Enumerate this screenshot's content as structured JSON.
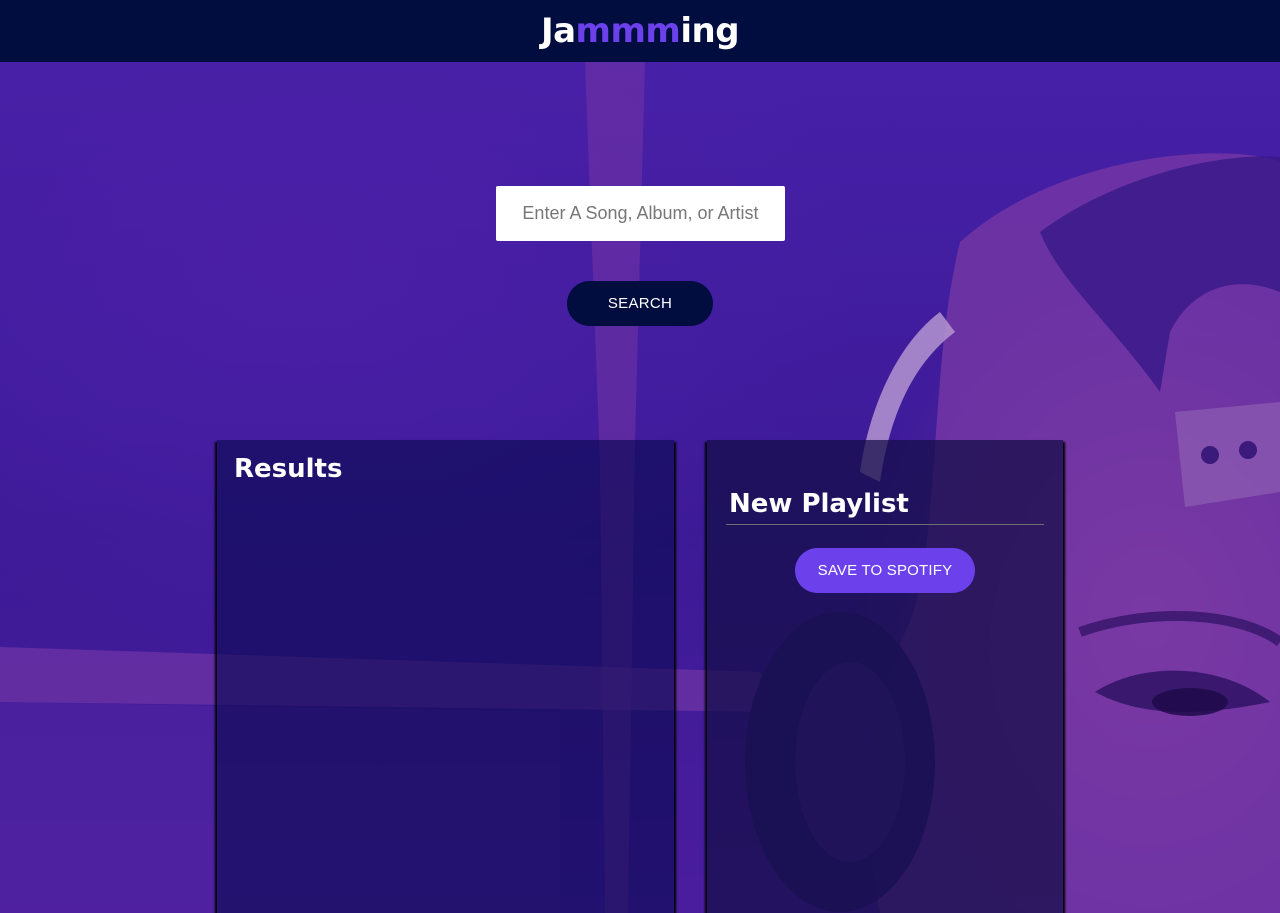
{
  "header": {
    "logo_prefix": "Ja",
    "logo_accent": "mmm",
    "logo_suffix": "ing"
  },
  "search": {
    "placeholder": "Enter A Song, Album, or Artist",
    "value": "",
    "button_label": "SEARCH"
  },
  "results": {
    "title": "Results"
  },
  "playlist": {
    "name": "New Playlist",
    "save_label": "SAVE TO SPOTIFY"
  },
  "colors": {
    "header_bg": "#010c3f",
    "accent": "#6c41ec",
    "background": "#3a1a8f"
  }
}
